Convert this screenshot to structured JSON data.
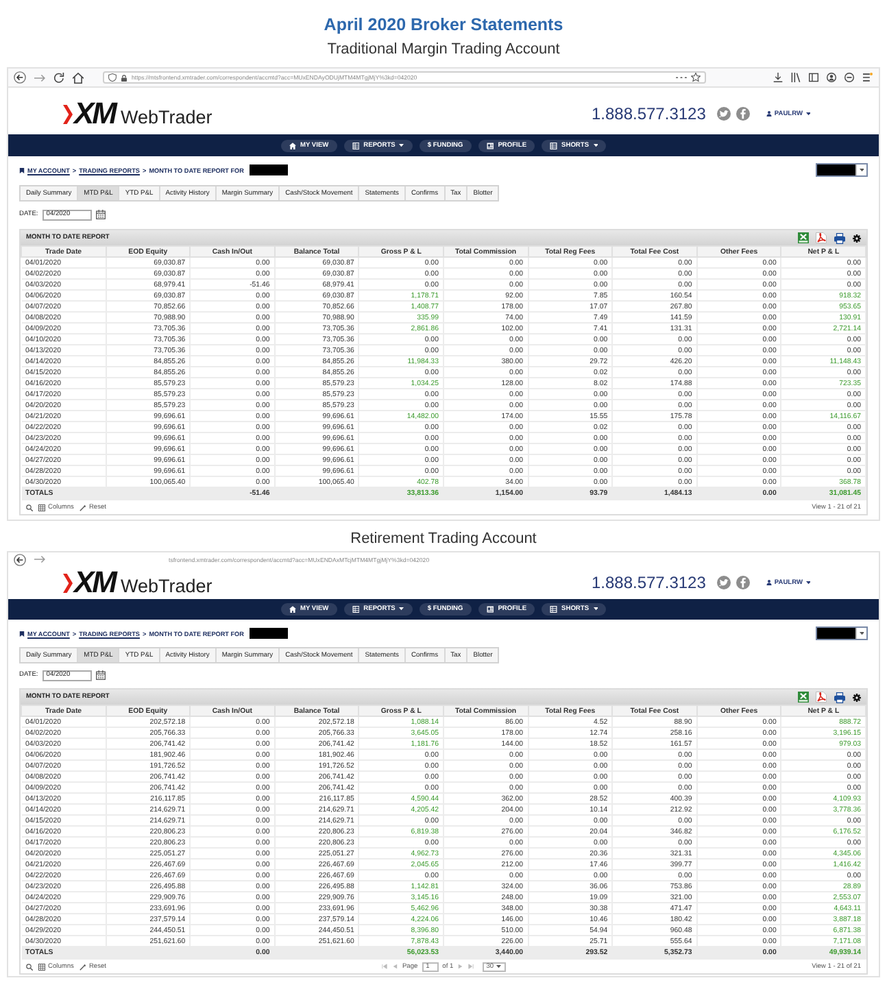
{
  "page": {
    "title": "April 2020 Broker Statements"
  },
  "accounts": [
    {
      "heading": "Traditional Margin Trading Account",
      "browser": {
        "kind": "full",
        "url": "https://mtsfrontend.xmtrader.com/correspondent/accmtd?acc=MUxENDAyODUjMTM4MTgjMjY%3kd=042020"
      },
      "header": {
        "logo_mark": "XM",
        "logo_name": "WebTrader",
        "phone": "1.888.577.3123",
        "user": "PAULRW"
      },
      "nav": [
        {
          "label": "MY VIEW",
          "dropdown": false
        },
        {
          "label": "REPORTS",
          "dropdown": true
        },
        {
          "label": "$ FUNDING",
          "dropdown": false
        },
        {
          "label": "PROFILE",
          "dropdown": false
        },
        {
          "label": "SHORTS",
          "dropdown": true
        }
      ],
      "breadcrumb": {
        "links": [
          {
            "label": "MY ACCOUNT",
            "separator": ">"
          },
          {
            "label": "TRADING REPORTS",
            "separator": ">"
          }
        ],
        "current": "MONTH TO DATE REPORT FOR"
      },
      "tabs": [
        {
          "label": "Daily Summary",
          "selected": false
        },
        {
          "label": "MTD P&L",
          "selected": true
        },
        {
          "label": "YTD P&L",
          "selected": false
        },
        {
          "label": "Activity History",
          "selected": false
        },
        {
          "label": "Margin Summary",
          "selected": false
        },
        {
          "label": "Cash/Stock Movement",
          "selected": false
        },
        {
          "label": "Statements",
          "selected": false
        },
        {
          "label": "Confirms",
          "selected": false
        },
        {
          "label": "Tax",
          "selected": false
        },
        {
          "label": "Blotter",
          "selected": false
        }
      ],
      "date_filter": {
        "label": "DATE:",
        "value": "04/2020"
      },
      "report": {
        "title": "MONTH TO DATE REPORT",
        "columns": [
          {
            "label": "Trade Date",
            "kind": "date"
          },
          {
            "label": "EOD Equity",
            "kind": "number"
          },
          {
            "label": "Cash In/Out",
            "kind": "number"
          },
          {
            "label": "Balance Total",
            "kind": "number"
          },
          {
            "label": "Gross P & L",
            "kind": "pnl"
          },
          {
            "label": "Total Commission",
            "kind": "number"
          },
          {
            "label": "Total Reg Fees",
            "kind": "number"
          },
          {
            "label": "Total Fee Cost",
            "kind": "number"
          },
          {
            "label": "Other Fees",
            "kind": "number"
          },
          {
            "label": "Net P & L",
            "kind": "pnl"
          }
        ],
        "rows": [
          {
            "cells": [
              "04/01/2020",
              "69,030.87",
              "0.00",
              "69,030.87",
              "0.00",
              "0.00",
              "0.00",
              "0.00",
              "0.00",
              "0.00"
            ],
            "gain": false
          },
          {
            "cells": [
              "04/02/2020",
              "69,030.87",
              "0.00",
              "69,030.87",
              "0.00",
              "0.00",
              "0.00",
              "0.00",
              "0.00",
              "0.00"
            ],
            "gain": false
          },
          {
            "cells": [
              "04/03/2020",
              "68,979.41",
              "-51.46",
              "68,979.41",
              "0.00",
              "0.00",
              "0.00",
              "0.00",
              "0.00",
              "0.00"
            ],
            "gain": false
          },
          {
            "cells": [
              "04/06/2020",
              "69,030.87",
              "0.00",
              "69,030.87",
              "1,178.71",
              "92.00",
              "7.85",
              "160.54",
              "0.00",
              "918.32"
            ],
            "gain": true
          },
          {
            "cells": [
              "04/07/2020",
              "70,852.66",
              "0.00",
              "70,852.66",
              "1,408.77",
              "178.00",
              "17.07",
              "267.80",
              "0.00",
              "953.65"
            ],
            "gain": true
          },
          {
            "cells": [
              "04/08/2020",
              "70,988.90",
              "0.00",
              "70,988.90",
              "335.99",
              "74.00",
              "7.49",
              "141.59",
              "0.00",
              "130.91"
            ],
            "gain": true
          },
          {
            "cells": [
              "04/09/2020",
              "73,705.36",
              "0.00",
              "73,705.36",
              "2,861.86",
              "102.00",
              "7.41",
              "131.31",
              "0.00",
              "2,721.14"
            ],
            "gain": true
          },
          {
            "cells": [
              "04/10/2020",
              "73,705.36",
              "0.00",
              "73,705.36",
              "0.00",
              "0.00",
              "0.00",
              "0.00",
              "0.00",
              "0.00"
            ],
            "gain": false
          },
          {
            "cells": [
              "04/13/2020",
              "73,705.36",
              "0.00",
              "73,705.36",
              "0.00",
              "0.00",
              "0.00",
              "0.00",
              "0.00",
              "0.00"
            ],
            "gain": false
          },
          {
            "cells": [
              "04/14/2020",
              "84,855.26",
              "0.00",
              "84,855.26",
              "11,984.33",
              "380.00",
              "29.72",
              "426.20",
              "0.00",
              "11,148.43"
            ],
            "gain": true
          },
          {
            "cells": [
              "04/15/2020",
              "84,855.26",
              "0.00",
              "84,855.26",
              "0.00",
              "0.00",
              "0.02",
              "0.00",
              "0.00",
              "0.00"
            ],
            "gain": false
          },
          {
            "cells": [
              "04/16/2020",
              "85,579.23",
              "0.00",
              "85,579.23",
              "1,034.25",
              "128.00",
              "8.02",
              "174.88",
              "0.00",
              "723.35"
            ],
            "gain": true
          },
          {
            "cells": [
              "04/17/2020",
              "85,579.23",
              "0.00",
              "85,579.23",
              "0.00",
              "0.00",
              "0.00",
              "0.00",
              "0.00",
              "0.00"
            ],
            "gain": false
          },
          {
            "cells": [
              "04/20/2020",
              "85,579.23",
              "0.00",
              "85,579.23",
              "0.00",
              "0.00",
              "0.00",
              "0.00",
              "0.00",
              "0.00"
            ],
            "gain": false
          },
          {
            "cells": [
              "04/21/2020",
              "99,696.61",
              "0.00",
              "99,696.61",
              "14,482.00",
              "174.00",
              "15.55",
              "175.78",
              "0.00",
              "14,116.67"
            ],
            "gain": true
          },
          {
            "cells": [
              "04/22/2020",
              "99,696.61",
              "0.00",
              "99,696.61",
              "0.00",
              "0.00",
              "0.02",
              "0.00",
              "0.00",
              "0.00"
            ],
            "gain": false
          },
          {
            "cells": [
              "04/23/2020",
              "99,696.61",
              "0.00",
              "99,696.61",
              "0.00",
              "0.00",
              "0.00",
              "0.00",
              "0.00",
              "0.00"
            ],
            "gain": false
          },
          {
            "cells": [
              "04/24/2020",
              "99,696.61",
              "0.00",
              "99,696.61",
              "0.00",
              "0.00",
              "0.00",
              "0.00",
              "0.00",
              "0.00"
            ],
            "gain": false
          },
          {
            "cells": [
              "04/27/2020",
              "99,696.61",
              "0.00",
              "99,696.61",
              "0.00",
              "0.00",
              "0.00",
              "0.00",
              "0.00",
              "0.00"
            ],
            "gain": false
          },
          {
            "cells": [
              "04/28/2020",
              "99,696.61",
              "0.00",
              "99,696.61",
              "0.00",
              "0.00",
              "0.00",
              "0.00",
              "0.00",
              "0.00"
            ],
            "gain": false
          },
          {
            "cells": [
              "04/30/2020",
              "100,065.40",
              "0.00",
              "100,065.40",
              "402.78",
              "34.00",
              "0.00",
              "0.00",
              "0.00",
              "368.78"
            ],
            "gain": true
          }
        ],
        "totals": {
          "cells": [
            "TOTALS",
            null,
            "-51.46",
            null,
            "33,813.36",
            "1,154.00",
            "93.79",
            "1,484.13",
            "0.00",
            "31,081.45"
          ],
          "gain": true
        },
        "footer": {
          "links": [
            "Columns",
            "Reset"
          ],
          "summary": "View 1 - 21 of 21"
        }
      }
    },
    {
      "heading": "Retirement Trading Account",
      "browser": {
        "kind": "partial",
        "url": "tsfrontend.xmtrader.com/correspondent/accmtd?acc=MUxENDAxMTcjMTM4MTgjMjY%3kd=042020"
      },
      "header": {
        "logo_mark": "XM",
        "logo_name": "WebTrader",
        "phone": "1.888.577.3123",
        "user": "PAULRW"
      },
      "nav": [
        {
          "label": "MY VIEW",
          "dropdown": false
        },
        {
          "label": "REPORTS",
          "dropdown": true
        },
        {
          "label": "$ FUNDING",
          "dropdown": false
        },
        {
          "label": "PROFILE",
          "dropdown": false
        },
        {
          "label": "SHORTS",
          "dropdown": true
        }
      ],
      "breadcrumb": {
        "links": [
          {
            "label": "MY ACCOUNT",
            "separator": ">"
          },
          {
            "label": "TRADING REPORTS",
            "separator": ">"
          }
        ],
        "current": "MONTH TO DATE REPORT FOR"
      },
      "tabs": [
        {
          "label": "Daily Summary",
          "selected": false
        },
        {
          "label": "MTD P&L",
          "selected": true
        },
        {
          "label": "YTD P&L",
          "selected": false
        },
        {
          "label": "Activity History",
          "selected": false
        },
        {
          "label": "Margin Summary",
          "selected": false
        },
        {
          "label": "Cash/Stock Movement",
          "selected": false
        },
        {
          "label": "Statements",
          "selected": false
        },
        {
          "label": "Confirms",
          "selected": false
        },
        {
          "label": "Tax",
          "selected": false
        },
        {
          "label": "Blotter",
          "selected": false
        }
      ],
      "date_filter": {
        "label": "DATE:",
        "value": "04/2020"
      },
      "report": {
        "title": "MONTH TO DATE REPORT",
        "columns": [
          {
            "label": "Trade Date",
            "kind": "date"
          },
          {
            "label": "EOD Equity",
            "kind": "number"
          },
          {
            "label": "Cash In/Out",
            "kind": "number"
          },
          {
            "label": "Balance Total",
            "kind": "number"
          },
          {
            "label": "Gross P & L",
            "kind": "pnl"
          },
          {
            "label": "Total Commission",
            "kind": "number"
          },
          {
            "label": "Total Reg Fees",
            "kind": "number"
          },
          {
            "label": "Total Fee Cost",
            "kind": "number"
          },
          {
            "label": "Other Fees",
            "kind": "number"
          },
          {
            "label": "Net P & L",
            "kind": "pnl"
          }
        ],
        "rows": [
          {
            "cells": [
              "04/01/2020",
              "202,572.18",
              "0.00",
              "202,572.18",
              "1,088.14",
              "86.00",
              "4.52",
              "88.90",
              "0.00",
              "888.72"
            ],
            "gain": true
          },
          {
            "cells": [
              "04/02/2020",
              "205,766.33",
              "0.00",
              "205,766.33",
              "3,645.05",
              "178.00",
              "12.74",
              "258.16",
              "0.00",
              "3,196.15"
            ],
            "gain": true
          },
          {
            "cells": [
              "04/03/2020",
              "206,741.42",
              "0.00",
              "206,741.42",
              "1,181.76",
              "144.00",
              "18.52",
              "161.57",
              "0.00",
              "979.03"
            ],
            "gain": true
          },
          {
            "cells": [
              "04/06/2020",
              "181,902.46",
              "0.00",
              "181,902.46",
              "0.00",
              "0.00",
              "0.00",
              "0.00",
              "0.00",
              "0.00"
            ],
            "gain": false
          },
          {
            "cells": [
              "04/07/2020",
              "191,726.52",
              "0.00",
              "191,726.52",
              "0.00",
              "0.00",
              "0.00",
              "0.00",
              "0.00",
              "0.00"
            ],
            "gain": false
          },
          {
            "cells": [
              "04/08/2020",
              "206,741.42",
              "0.00",
              "206,741.42",
              "0.00",
              "0.00",
              "0.00",
              "0.00",
              "0.00",
              "0.00"
            ],
            "gain": false
          },
          {
            "cells": [
              "04/09/2020",
              "206,741.42",
              "0.00",
              "206,741.42",
              "0.00",
              "0.00",
              "0.00",
              "0.00",
              "0.00",
              "0.00"
            ],
            "gain": false
          },
          {
            "cells": [
              "04/13/2020",
              "216,117.85",
              "0.00",
              "216,117.85",
              "4,590.44",
              "362.00",
              "28.52",
              "400.39",
              "0.00",
              "4,109.93"
            ],
            "gain": true
          },
          {
            "cells": [
              "04/14/2020",
              "214,629.71",
              "0.00",
              "214,629.71",
              "4,205.42",
              "204.00",
              "10.14",
              "212.92",
              "0.00",
              "3,778.36"
            ],
            "gain": true
          },
          {
            "cells": [
              "04/15/2020",
              "214,629.71",
              "0.00",
              "214,629.71",
              "0.00",
              "0.00",
              "0.00",
              "0.00",
              "0.00",
              "0.00"
            ],
            "gain": false
          },
          {
            "cells": [
              "04/16/2020",
              "220,806.23",
              "0.00",
              "220,806.23",
              "6,819.38",
              "276.00",
              "20.04",
              "346.82",
              "0.00",
              "6,176.52"
            ],
            "gain": true
          },
          {
            "cells": [
              "04/17/2020",
              "220,806.23",
              "0.00",
              "220,806.23",
              "0.00",
              "0.00",
              "0.00",
              "0.00",
              "0.00",
              "0.00"
            ],
            "gain": false
          },
          {
            "cells": [
              "04/20/2020",
              "225,051.27",
              "0.00",
              "225,051.27",
              "4,962.73",
              "276.00",
              "20.36",
              "321.31",
              "0.00",
              "4,345.06"
            ],
            "gain": true
          },
          {
            "cells": [
              "04/21/2020",
              "226,467.69",
              "0.00",
              "226,467.69",
              "2,045.65",
              "212.00",
              "17.46",
              "399.77",
              "0.00",
              "1,416.42"
            ],
            "gain": true
          },
          {
            "cells": [
              "04/22/2020",
              "226,467.69",
              "0.00",
              "226,467.69",
              "0.00",
              "0.00",
              "0.00",
              "0.00",
              "0.00",
              "0.00"
            ],
            "gain": false
          },
          {
            "cells": [
              "04/23/2020",
              "226,495.88",
              "0.00",
              "226,495.88",
              "1,142.81",
              "324.00",
              "36.06",
              "753.86",
              "0.00",
              "28.89"
            ],
            "gain": true
          },
          {
            "cells": [
              "04/24/2020",
              "229,909.76",
              "0.00",
              "229,909.76",
              "3,145.16",
              "248.00",
              "19.09",
              "321.00",
              "0.00",
              "2,553.07"
            ],
            "gain": true
          },
          {
            "cells": [
              "04/27/2020",
              "233,691.96",
              "0.00",
              "233,691.96",
              "5,462.96",
              "348.00",
              "30.38",
              "471.47",
              "0.00",
              "4,643.11"
            ],
            "gain": true
          },
          {
            "cells": [
              "04/28/2020",
              "237,579.14",
              "0.00",
              "237,579.14",
              "4,224.06",
              "146.00",
              "10.46",
              "180.42",
              "0.00",
              "3,887.18"
            ],
            "gain": true
          },
          {
            "cells": [
              "04/29/2020",
              "244,450.51",
              "0.00",
              "244,450.51",
              "8,396.80",
              "510.00",
              "54.94",
              "960.48",
              "0.00",
              "6,871.38"
            ],
            "gain": true
          },
          {
            "cells": [
              "04/30/2020",
              "251,621.60",
              "0.00",
              "251,621.60",
              "7,878.43",
              "226.00",
              "25.71",
              "555.64",
              "0.00",
              "7,171.08"
            ],
            "gain": true
          }
        ],
        "totals": {
          "cells": [
            "TOTALS",
            null,
            "0.00",
            null,
            "56,023.53",
            "3,440.00",
            "293.52",
            "5,352.73",
            "0.00",
            "49,939.14"
          ],
          "gain": true
        },
        "footer": {
          "links": [
            "Columns",
            "Reset"
          ],
          "pager": {
            "label": "Page",
            "value": "1",
            "total": "of 1",
            "page_size": "30"
          },
          "summary": "View 1 - 21 of 21"
        }
      }
    }
  ]
}
